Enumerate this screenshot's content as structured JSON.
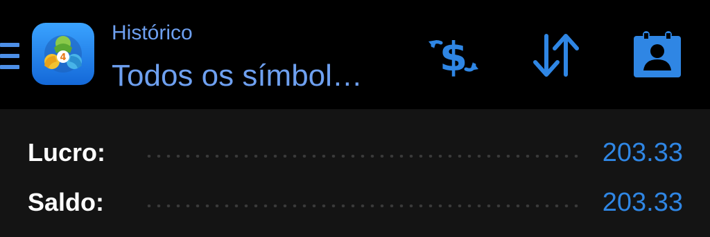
{
  "header": {
    "subtitle": "Histórico",
    "title": "Todos os símbol…",
    "icons": {
      "menu": "hamburger-menu-icon",
      "app_logo": "metatrader-4-logo",
      "currency": "currency-exchange-icon",
      "sort": "sort-arrows-icon",
      "contact": "contact-card-icon"
    }
  },
  "summary": {
    "rows": [
      {
        "label": "Lucro:",
        "value": "203.33"
      },
      {
        "label": "Saldo:",
        "value": "203.33"
      }
    ]
  },
  "colors": {
    "background": "#000000",
    "panel": "#141414",
    "accent": "#2f86e4",
    "title_text": "#6ea0f0",
    "label_text": "#ffffff"
  }
}
